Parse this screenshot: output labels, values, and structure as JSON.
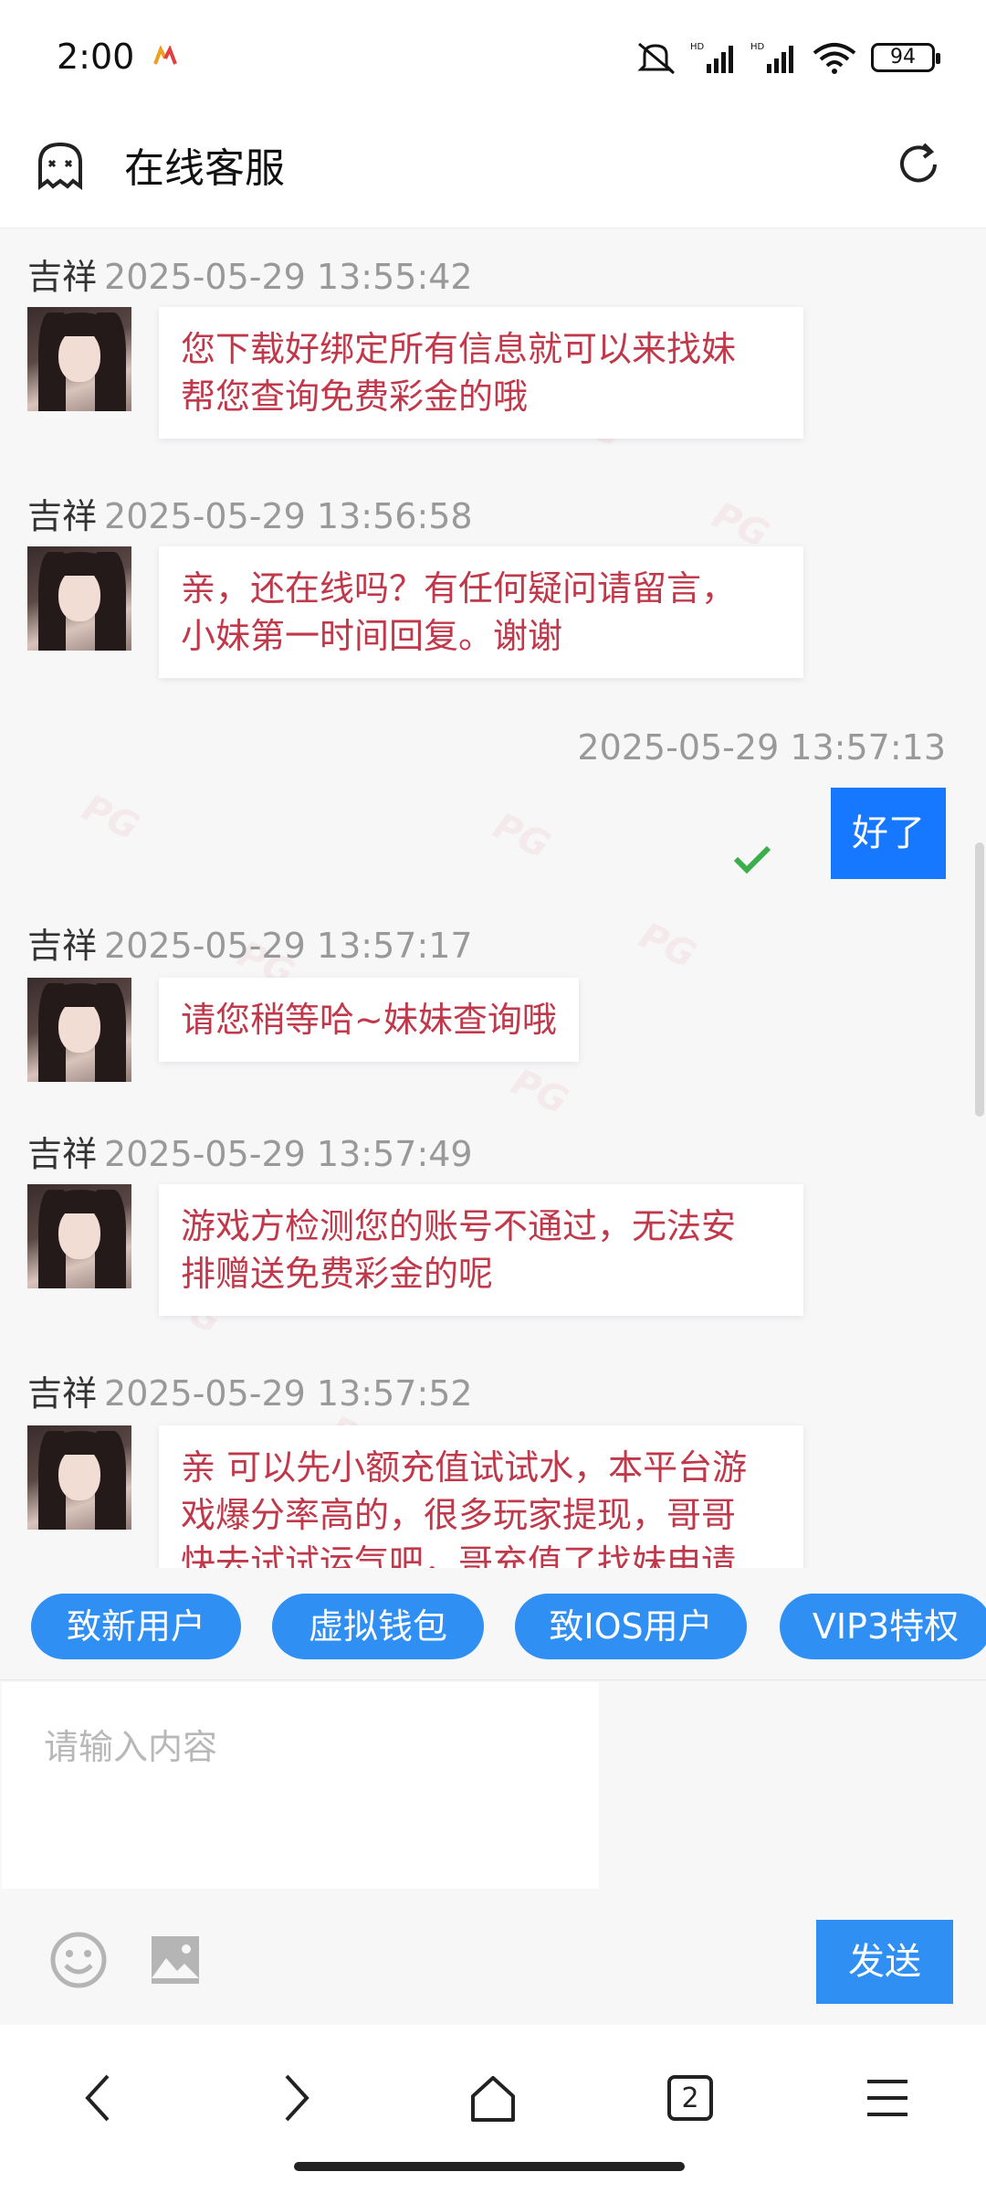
{
  "status_bar": {
    "time": "2:00",
    "battery": "94"
  },
  "header": {
    "title": "在线客服"
  },
  "messages": [
    {
      "sender": "吉祥",
      "time": "2025-05-29 13:55:42",
      "lines": [
        "您下载好绑定所有信息就可以来找妹",
        "帮您查询免费彩金的哦"
      ]
    },
    {
      "sender": "吉祥",
      "time": "2025-05-29 13:56:58",
      "lines": [
        "亲，还在线吗？有任何疑问请留言，",
        "小妹第一时间回复。谢谢"
      ]
    },
    {
      "sender": "吉祥",
      "time": "2025-05-29 13:57:17",
      "lines": [
        "请您稍等哈~妹妹查询哦"
      ]
    },
    {
      "sender": "吉祥",
      "time": "2025-05-29 13:57:49",
      "lines": [
        "游戏方检测您的账号不通过，无法安",
        "排赠送免费彩金的呢"
      ]
    },
    {
      "sender": "吉祥",
      "time": "2025-05-29 13:57:52",
      "lines": [
        "亲 可以先小额充值试试水，本平台游",
        "戏爆分率高的，很多玩家提现，哥哥",
        "快去试试运气吧，哥充值了找妹申请"
      ]
    }
  ],
  "my_message": {
    "time": "2025-05-29 13:57:13",
    "text": "好了"
  },
  "quick_replies": [
    "致新用户",
    "虚拟钱包",
    "致IOS用户",
    "VIP3特权"
  ],
  "input": {
    "placeholder": "请输入内容",
    "value": ""
  },
  "send_label": "发送",
  "nav": {
    "tab_count": "2"
  },
  "colors": {
    "accent": "#2f8ff3",
    "my_bubble": "#1677ff",
    "agent_text": "#c0394b",
    "check": "#3cae4a"
  }
}
